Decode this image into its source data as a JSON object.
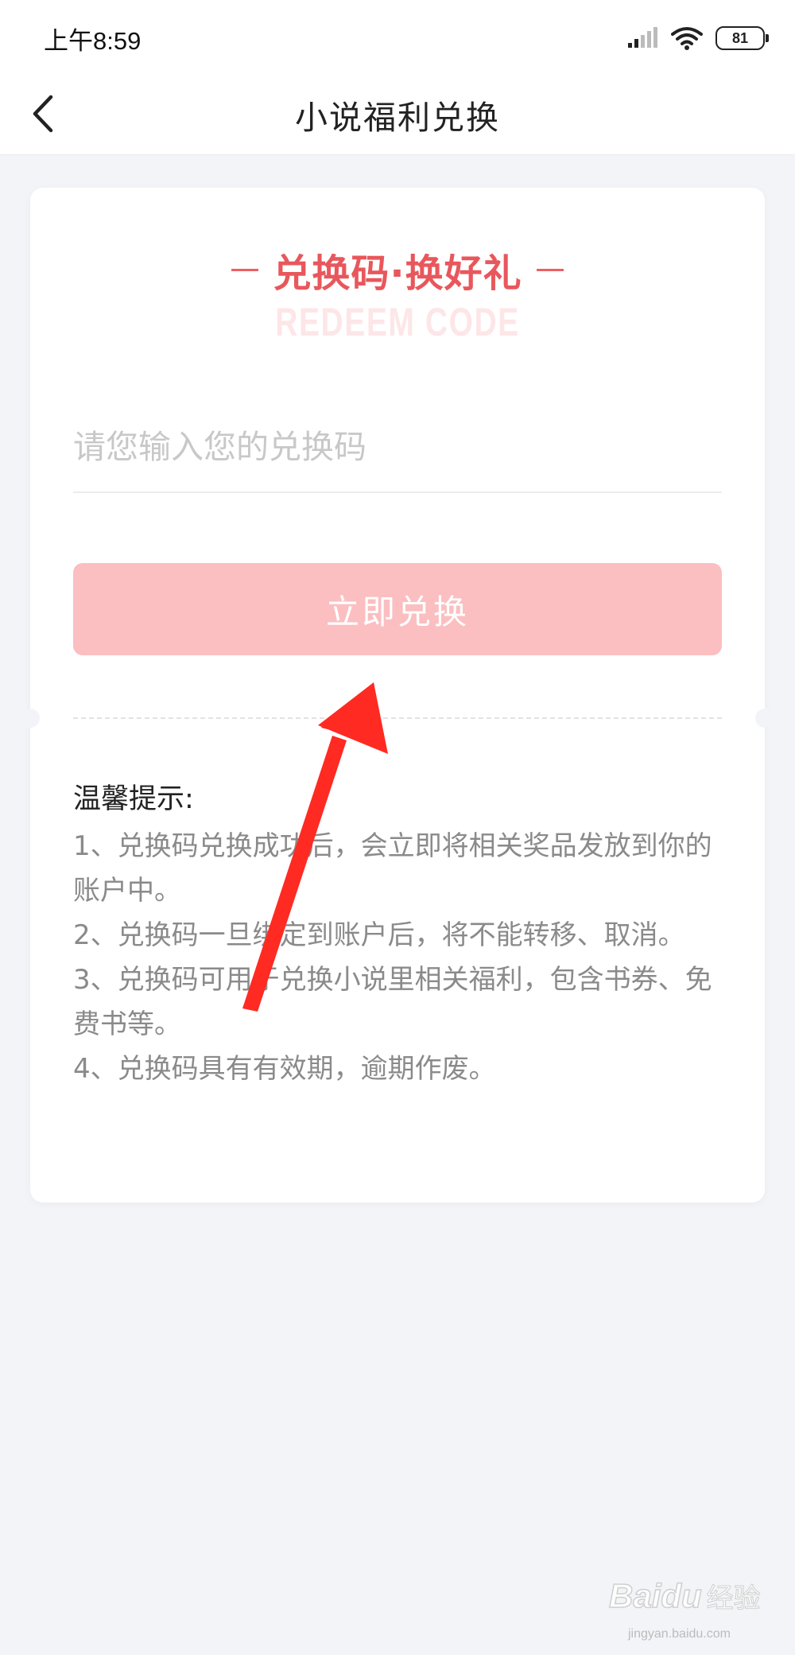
{
  "status_bar": {
    "time": "上午8:59",
    "battery": "81",
    "icons": [
      "signal-icon",
      "wifi-icon",
      "battery-icon"
    ]
  },
  "nav": {
    "title": "小说福利兑换",
    "back_icon": "chevron-left-icon"
  },
  "card": {
    "heading": "兑换码·换好礼",
    "subheading": "REDEEM CODE",
    "input_placeholder": "请您输入您的兑换码",
    "input_value": "",
    "button_label": "立即兑换",
    "tips_title": "温馨提示:",
    "tips": [
      "1、兑换码兑换成功后，会立即将相关奖品发放到你的账户中。",
      "2、兑换码一旦绑定到账户后，将不能转移、取消。",
      "3、兑换码可用于兑换小说里相关福利，包含书券、免费书等。",
      "4、兑换码具有有效期，逾期作废。"
    ]
  },
  "colors": {
    "accent": "#e8575c",
    "button_bg": "#fbbfc1",
    "annotation_arrow": "#ff2a22",
    "page_bg": "#f3f4f8"
  },
  "watermark": {
    "brand": "Baidu",
    "suffix": "经验",
    "url": "jingyan.baidu.com"
  }
}
